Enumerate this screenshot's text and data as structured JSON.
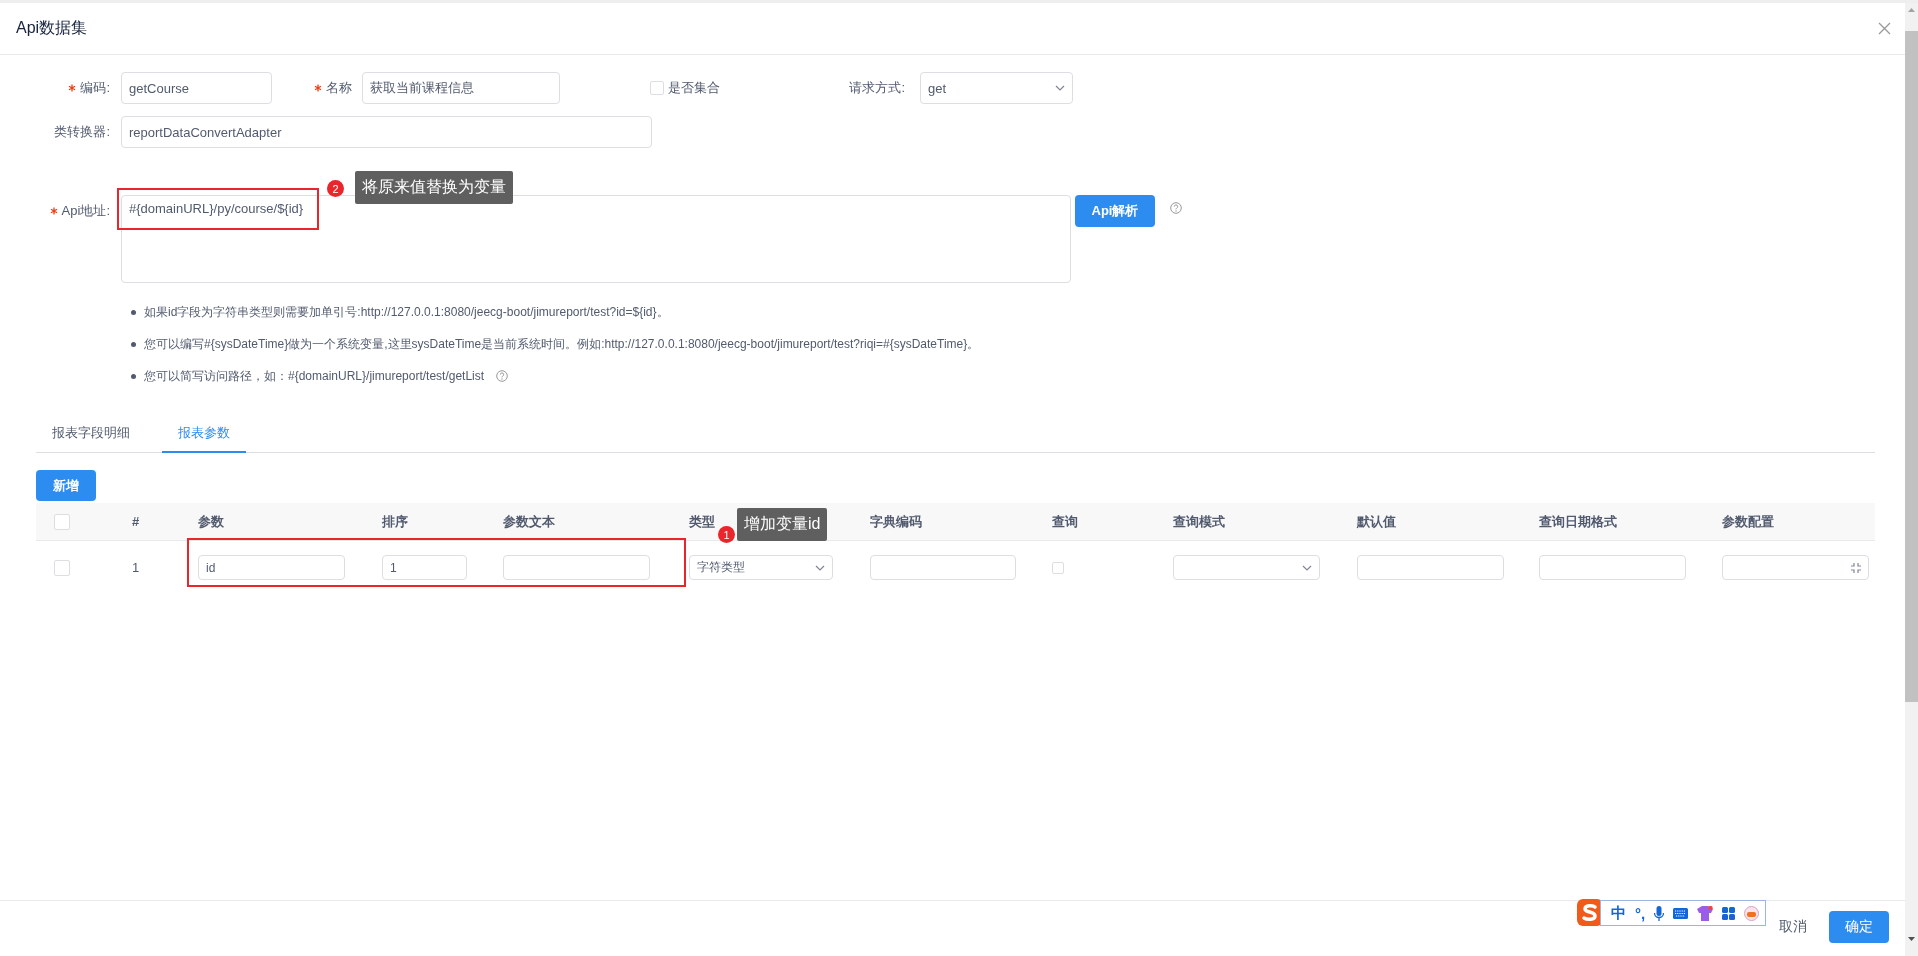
{
  "dialog": {
    "title": "Api数据集"
  },
  "form": {
    "code": {
      "label": "编码:",
      "required": true,
      "value": "getCourse"
    },
    "name": {
      "label": "名称",
      "required": true,
      "value": "获取当前课程信息"
    },
    "is_collection": {
      "label": "是否集合",
      "checked": false
    },
    "method": {
      "label": "请求方式:",
      "value": "get"
    },
    "converter": {
      "label": "类转换器:",
      "required": false,
      "value": "reportDataConvertAdapter"
    },
    "api_url": {
      "label": "Api地址:",
      "required": true,
      "value": "#{domainURL}/py/course/${id}"
    },
    "parse_button": "Api解析"
  },
  "notes": [
    {
      "text": "如果id字段为字符串类型则需要加单引号:http://127.0.0.1:8080/jeecg-boot/jimureport/test?id=${id}。",
      "help": false
    },
    {
      "text": "您可以编写#{sysDateTime}做为一个系统变量,这里sysDateTime是当前系统时间。例如:http://127.0.0.1:8080/jeecg-boot/jimureport/test?riqi=#{sysDateTime}。",
      "help": false
    },
    {
      "text": "您可以简写访问路径，如：#{domainURL}/jimureport/test/getList",
      "help": true
    }
  ],
  "tabs": [
    {
      "label": "报表字段明细",
      "selected": false
    },
    {
      "label": "报表参数",
      "selected": true
    }
  ],
  "add_button": "新增",
  "table": {
    "header_checked": false,
    "columns": [
      "#",
      "参数",
      "排序",
      "参数文本",
      "类型",
      "字典编码",
      "查询",
      "查询模式",
      "默认值",
      "查询日期格式",
      "参数配置"
    ],
    "rows": [
      {
        "checked": false,
        "index": "1",
        "param": "id",
        "order": "1",
        "type": "字符类型",
        "query": false
      }
    ]
  },
  "annotations": [
    {
      "number": "2",
      "text": "将原来值替换为变量"
    },
    {
      "number": "1",
      "text": "增加变量id"
    }
  ],
  "footer": {
    "cancel": "取消",
    "ok": "确定"
  },
  "ime_toolbar": {
    "mode": "中",
    "punctuation": "°,"
  }
}
